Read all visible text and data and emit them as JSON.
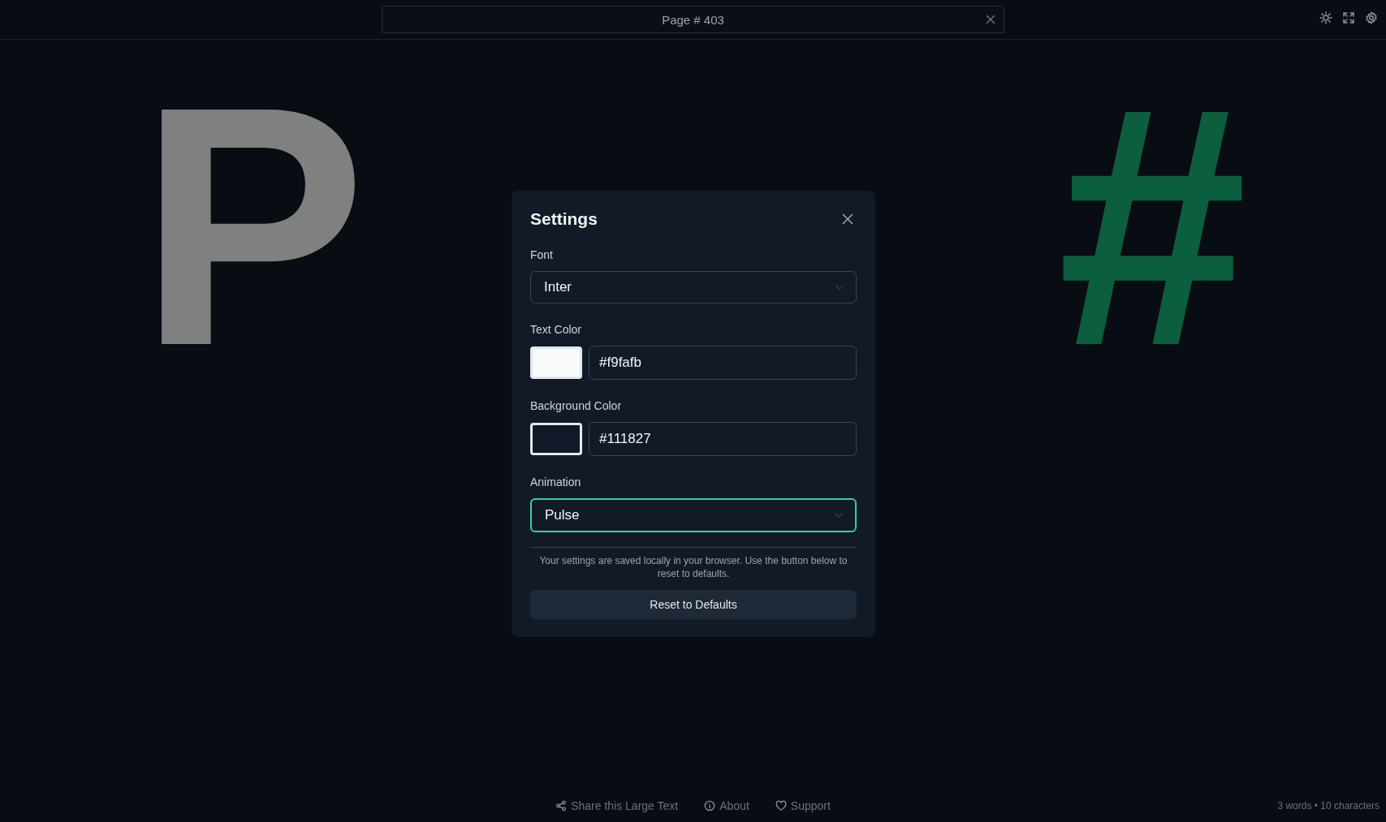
{
  "title_field": {
    "value": "Page # 403"
  },
  "display": {
    "words": [
      {
        "text": "P",
        "color": "#7f8080"
      },
      {
        "text": "#",
        "color": "#0b5e3e"
      }
    ]
  },
  "settings": {
    "title": "Settings",
    "fields": [
      {
        "kind": "select",
        "label": "Font",
        "value": "Inter",
        "focused": false
      },
      {
        "kind": "color",
        "label": "Text Color",
        "color": "#f9fafb",
        "value": "#f9fafb"
      },
      {
        "kind": "color",
        "label": "Background Color",
        "color": "#111827",
        "value": "#111827"
      },
      {
        "kind": "select",
        "label": "Animation",
        "value": "Pulse",
        "focused": true
      }
    ],
    "note": "Your settings are saved locally in your browser. Use the button below to reset to defaults.",
    "reset_button": "Reset to Defaults"
  },
  "footer": {
    "links": [
      {
        "label": "Share this Large Text"
      },
      {
        "label": "About"
      },
      {
        "label": "Support"
      }
    ],
    "stats": "3 words • 10 characters"
  }
}
